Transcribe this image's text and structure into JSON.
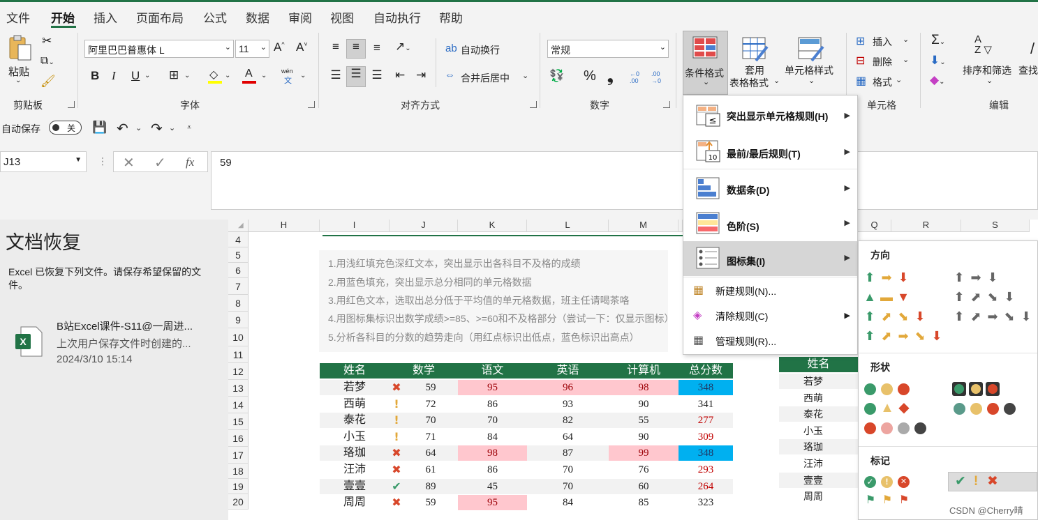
{
  "tabs": [
    "文件",
    "开始",
    "插入",
    "页面布局",
    "公式",
    "数据",
    "审阅",
    "视图",
    "自动执行",
    "帮助"
  ],
  "ribbon": {
    "clipboard": {
      "paste": "粘贴",
      "group": "剪贴板"
    },
    "font": {
      "name": "阿里巴巴普惠体 L",
      "size": "11",
      "bold": "B",
      "italic": "I",
      "underline": "U",
      "grow": "A^",
      "shrink": "A˅",
      "phonetic": "wén",
      "phonetic_char": "文",
      "group": "字体"
    },
    "align": {
      "wrap": "自动换行",
      "merge": "合并后居中",
      "group": "对齐方式"
    },
    "number": {
      "format": "常规",
      "percent": "%",
      "comma": "❟",
      "inc": ".0→.00",
      "dec": ".00→.0",
      "group": "数字"
    },
    "styles": {
      "cond": "条件格式",
      "table_l1": "套用",
      "table_l2": "表格格式",
      "cell": "单元格样式"
    },
    "cells": {
      "insert": "插入",
      "delete": "删除",
      "format": "格式",
      "group": "单元格"
    },
    "edit": {
      "sort": "排序和筛选",
      "find": "查找",
      "group": "编辑"
    }
  },
  "qat": {
    "autosave": "自动保存",
    "toggle": "关"
  },
  "formula": {
    "namebox": "J13",
    "fx": "fx",
    "value": "59"
  },
  "recovery": {
    "title": "文档恢复",
    "desc": "Excel 已恢复下列文件。请保存希望保留的文件。",
    "file_name": "B站Excel课件-S11@一周进...",
    "file_desc": "上次用户保存文件时创建的...",
    "file_time": "2024/3/10 15:14"
  },
  "columns": [
    "H",
    "I",
    "J",
    "K",
    "L",
    "M",
    "",
    "Q",
    "R",
    "S"
  ],
  "rows": [
    "4",
    "5",
    "6",
    "7",
    "8",
    "9",
    "10",
    "11",
    "12",
    "13",
    "14",
    "15",
    "16",
    "17",
    "18",
    "19",
    "20"
  ],
  "notes": [
    "1.用浅红填充色深红文本，突出显示出各科目不及格的成绩",
    "2.用蓝色填充，突出显示总分相同的单元格数据",
    "3.用红色文本，选取出总分低于平均值的单元格数据，班主任请喝茶咯",
    "4.用图标集标识出数学成绩>=85、>=60和不及格部分（尝试一下：仅显示图标）",
    "5.分析各科目的分数的趋势走向（用红点标识出低点，蓝色标识出高点）"
  ],
  "table": {
    "headers": [
      "姓名",
      "数学",
      "语文",
      "英语",
      "计算机",
      "总分数"
    ],
    "rows": [
      {
        "name": "若梦",
        "icon": "✖",
        "math": "59",
        "chinese": "95",
        "english": "96",
        "computer": "98",
        "total": "348"
      },
      {
        "name": "西萌",
        "icon": "!",
        "math": "72",
        "chinese": "86",
        "english": "93",
        "computer": "90",
        "total": "341"
      },
      {
        "name": "泰花",
        "icon": "!",
        "math": "70",
        "chinese": "70",
        "english": "82",
        "computer": "55",
        "total": "277"
      },
      {
        "name": "小玉",
        "icon": "!",
        "math": "71",
        "chinese": "84",
        "english": "64",
        "computer": "90",
        "total": "309"
      },
      {
        "name": "珞珈",
        "icon": "✖",
        "math": "64",
        "chinese": "98",
        "english": "87",
        "computer": "99",
        "total": "348"
      },
      {
        "name": "汪沛",
        "icon": "✖",
        "math": "61",
        "chinese": "86",
        "english": "70",
        "computer": "76",
        "total": "293"
      },
      {
        "name": "壹壹",
        "icon": "✔",
        "math": "89",
        "chinese": "45",
        "english": "70",
        "computer": "60",
        "total": "264"
      },
      {
        "name": "周周",
        "icon": "✖",
        "math": "59",
        "chinese": "95",
        "english": "84",
        "computer": "85",
        "total": "323"
      }
    ]
  },
  "side_table": {
    "header": "姓名",
    "names": [
      "若梦",
      "西萌",
      "泰花",
      "小玉",
      "珞珈",
      "汪沛",
      "壹壹",
      "周周"
    ]
  },
  "menu": {
    "items": [
      "突出显示单元格规则(H)",
      "最前/最后规则(T)",
      "数据条(D)",
      "色阶(S)",
      "图标集(I)"
    ],
    "small": [
      "新建规则(N)...",
      "清除规则(C)",
      "管理规则(R)..."
    ]
  },
  "submenu": {
    "directional": "方向",
    "shapes": "形状",
    "indicators": "标记"
  },
  "watermark": "CSDN @Cherry晴",
  "colors": {
    "green": "#217346",
    "pink": "#ffc7ce",
    "pink_text": "#9c0006",
    "blue": "#00b0f0",
    "red_text": "#c00000"
  }
}
